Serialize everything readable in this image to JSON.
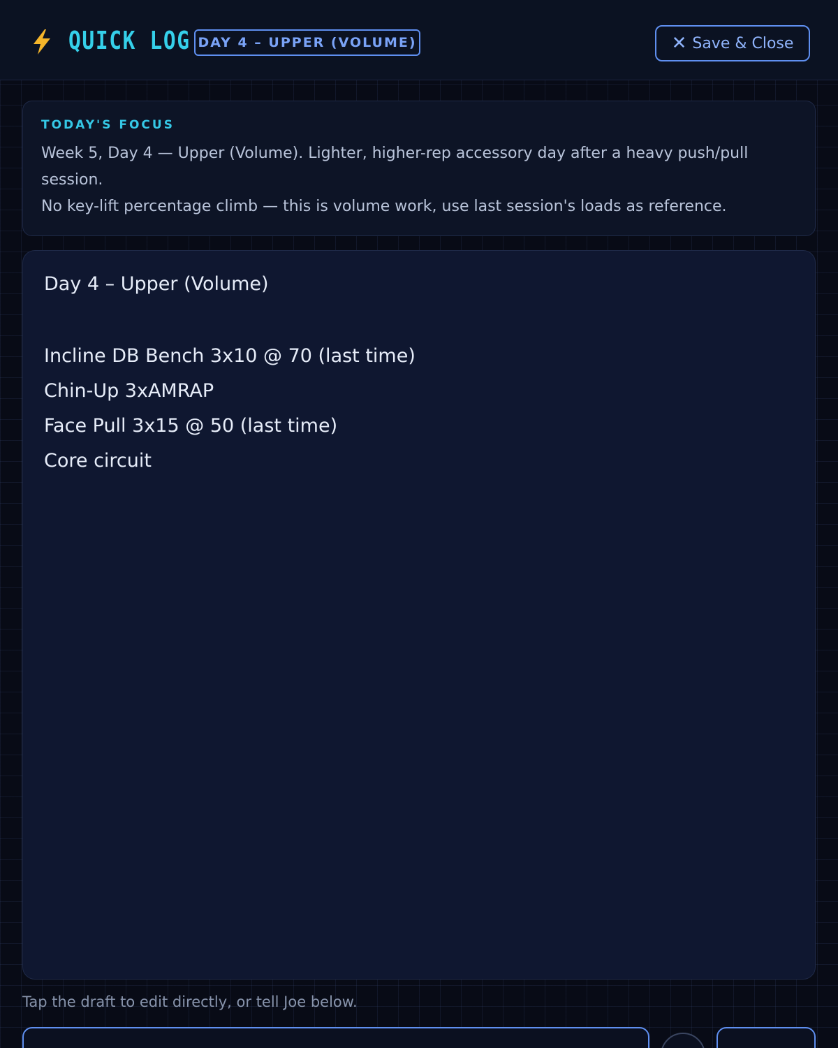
{
  "header": {
    "icon": "lightning-bolt-icon",
    "title": "QUICK LOG",
    "day_badge": "DAY 4 – UPPER (VOLUME)",
    "close_label": "Save & Close",
    "close_icon": "close-icon"
  },
  "focus": {
    "label": "TODAY'S FOCUS",
    "line1": "Week 5, Day 4 — Upper (Volume). Lighter, higher-rep accessory day after a heavy push/pull session.",
    "line2": "No key-lift percentage climb — this is volume work, use last session's loads as reference."
  },
  "draft": {
    "title": "Day 4 – Upper (Volume)",
    "lines": [
      "Incline DB Bench 3x10 @ 70 (last time)",
      "Chin-Up 3xAMRAP",
      "Face Pull 3x15 @ 50 (last time)",
      "Core circuit"
    ]
  },
  "footer": {
    "hint": "Tap the draft to edit directly, or tell Joe below."
  },
  "colors": {
    "accent_cyan": "#35d0ea",
    "accent_blue": "#5f8ff0",
    "background": "#080b16"
  }
}
